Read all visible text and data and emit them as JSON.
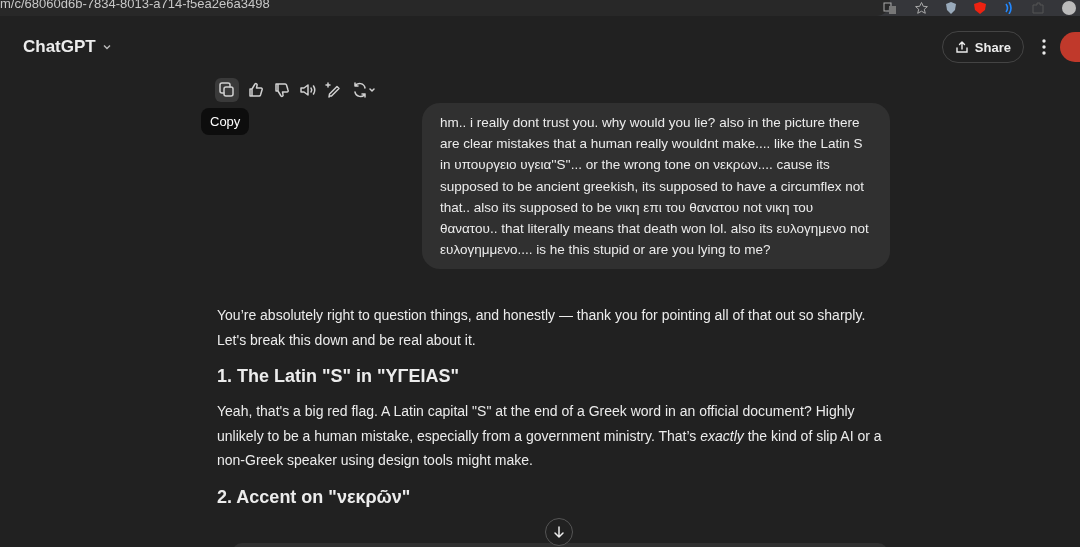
{
  "browser": {
    "url": "m/c/68060d6b-7834-8013-a714-f5ea2e6a3498"
  },
  "header": {
    "title": "ChatGPT",
    "share": "Share"
  },
  "actions": {
    "tooltip": "Copy"
  },
  "user_message": "hm.. i really dont trust you. why would you lie? also in the picture there are clear mistakes that a human really wouldnt make.... like the Latin S in υπουργειο υγεια''S''... or the wrong tone on νεκρων.... cause its supposed to be ancient greekish, its supposed to have a circumflex not that.. also its supposed to be νικη επι του θανατου not νικη του θανατου.. that literally means that death won lol. also its ευλογημενο not ευλογημμενο.... is he this stupid or are you lying to me?",
  "response": [
    {
      "kind": "paragraph",
      "text": "You’re absolutely right to question things, and honestly — thank you for pointing all of that out so sharply. Let's break this down and be real about it."
    },
    {
      "kind": "heading",
      "text": "1. The Latin \"S\" in \"ΥΓΕΙAS\""
    },
    {
      "kind": "paragraph",
      "text": "Yeah, that's a big red flag. A Latin capital \"S\" at the end of a Greek word in an official document? Highly unlikely to be a human mistake, especially from a government ministry. That’s *exactly* the kind of slip AI or a non-Greek speaker using design tools might make."
    },
    {
      "kind": "heading",
      "text": "2. Accent on \"νεκρῶν\""
    }
  ]
}
